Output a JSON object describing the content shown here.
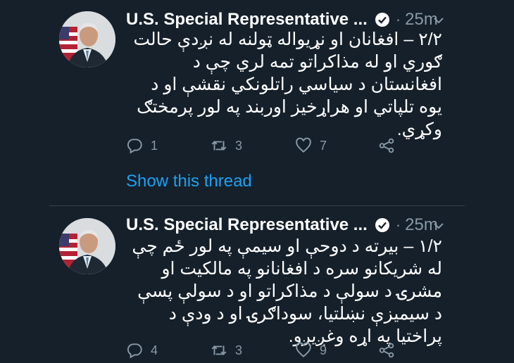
{
  "tweets": [
    {
      "author": "U.S. Special Representative ...",
      "time": "25m",
      "body": "۲/۲ – افغانان او نړیواله ټولنه له نږدې حالت ګوري او له مذاکراتو تمه لري چې د افغانستان د سیاسي راتلونکي نقشې او د یوه تلپاتي او هراړخیز اوربند په لور پرمختګ وکړي.",
      "replies": "1",
      "retweets": "3",
      "likes": "7",
      "show_thread": "Show this thread"
    },
    {
      "author": "U.S. Special Representative ...",
      "time": "25m",
      "body": "۱/۲ – بیرته د دوحې او سیمې په لور ځم چې له شریکانو سره د افغانانو په مالکیت او مشرۍ د سولې د مذاکراتو او د سولې پسې د سیمیزې نښلتیا، سوداګرۍ او د ودې د پراختیا په اړه وغږیږو.",
      "replies": "4",
      "retweets": "3",
      "likes": "9"
    }
  ],
  "icons": {
    "reply": "reply-icon",
    "retweet": "retweet-icon",
    "like": "heart-icon",
    "share": "share-icon",
    "verified": "verified-badge-icon",
    "caret": "chevron-down-icon"
  },
  "colors": {
    "background": "#15202b",
    "text": "#ffffff",
    "muted": "#8899a6",
    "link": "#1da1f2",
    "divider": "#38444d"
  }
}
